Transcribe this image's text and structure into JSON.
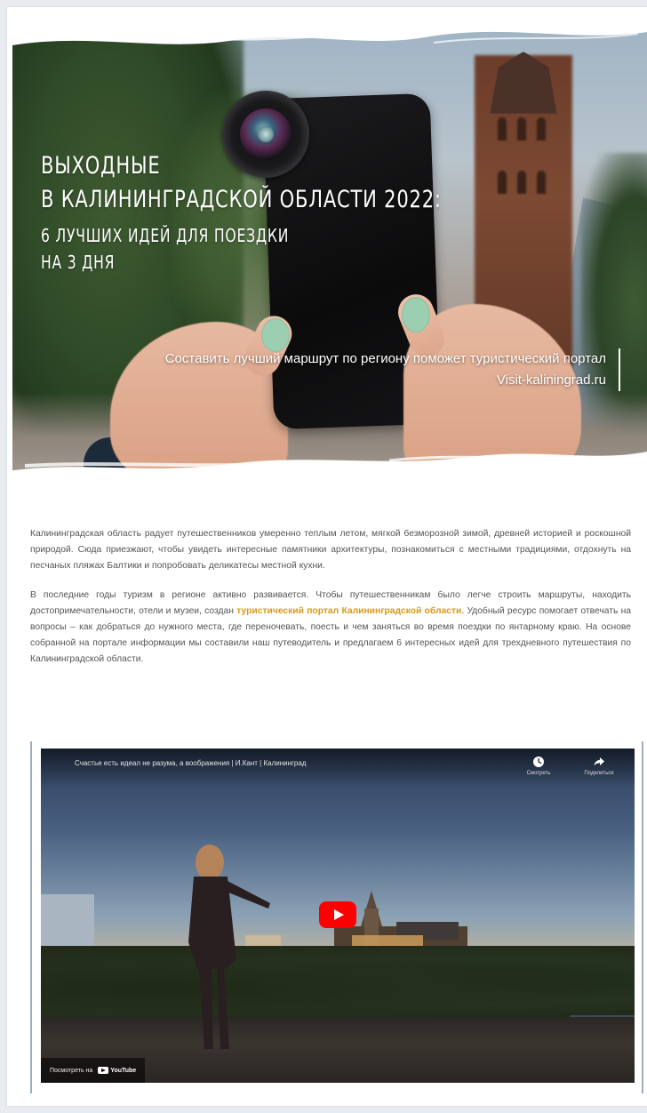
{
  "hero": {
    "title_line1": "Выходные",
    "title_line2": "в Калининградской области 2022:",
    "title_line3": "6 лучших идей для поездки",
    "title_line4": "на 3 дня",
    "caption_line1": "Составить лучший маршрут по региону поможет туристический портал",
    "caption_line2": "Visit-kaliningrad.ru"
  },
  "article": {
    "p1": "Калининградская область радует путешественников умеренно теплым летом, мягкой безморозной зимой, древней историей и роскошной природой. Сюда приезжают, чтобы увидеть интересные памятники архитектуры, познакомиться с местными традициями, отдохнуть на песчаных пляжах Балтики и попробовать деликатесы местной кухни.",
    "p2_before": "В последние годы туризм в регионе активно развивается. Чтобы путешественникам было легче строить маршруты, находить достопримечательности, отели и музеи, создан ",
    "p2_link": "туристический портал Калининградской области",
    "p2_after": ". Удобный ресурс помогает отвечать на вопросы – как добраться до нужного места, где переночевать, поесть и чем заняться во время поездки по янтарному краю. На основе собранной на портале информации мы составили наш путеводитель и предлагаем 6 интересных идей для трехдневного путешествия по Калининградской области."
  },
  "video": {
    "title": "Счастье есть идеал не разума, а воображения | И.Кант | Калининград",
    "watch_later_label": "Смотреть",
    "share_label": "Поделиться",
    "watch_on_label": "Посмотреть на",
    "youtube_label": "YouTube",
    "icons": {
      "watch_later": "clock-icon",
      "share": "share-icon",
      "play": "play-icon",
      "youtube": "youtube-logo-icon"
    }
  },
  "colors": {
    "accent_link": "#d69a1a",
    "body_text": "#555555",
    "play_button": "#ff0000",
    "video_border": "#9ab0bd"
  }
}
